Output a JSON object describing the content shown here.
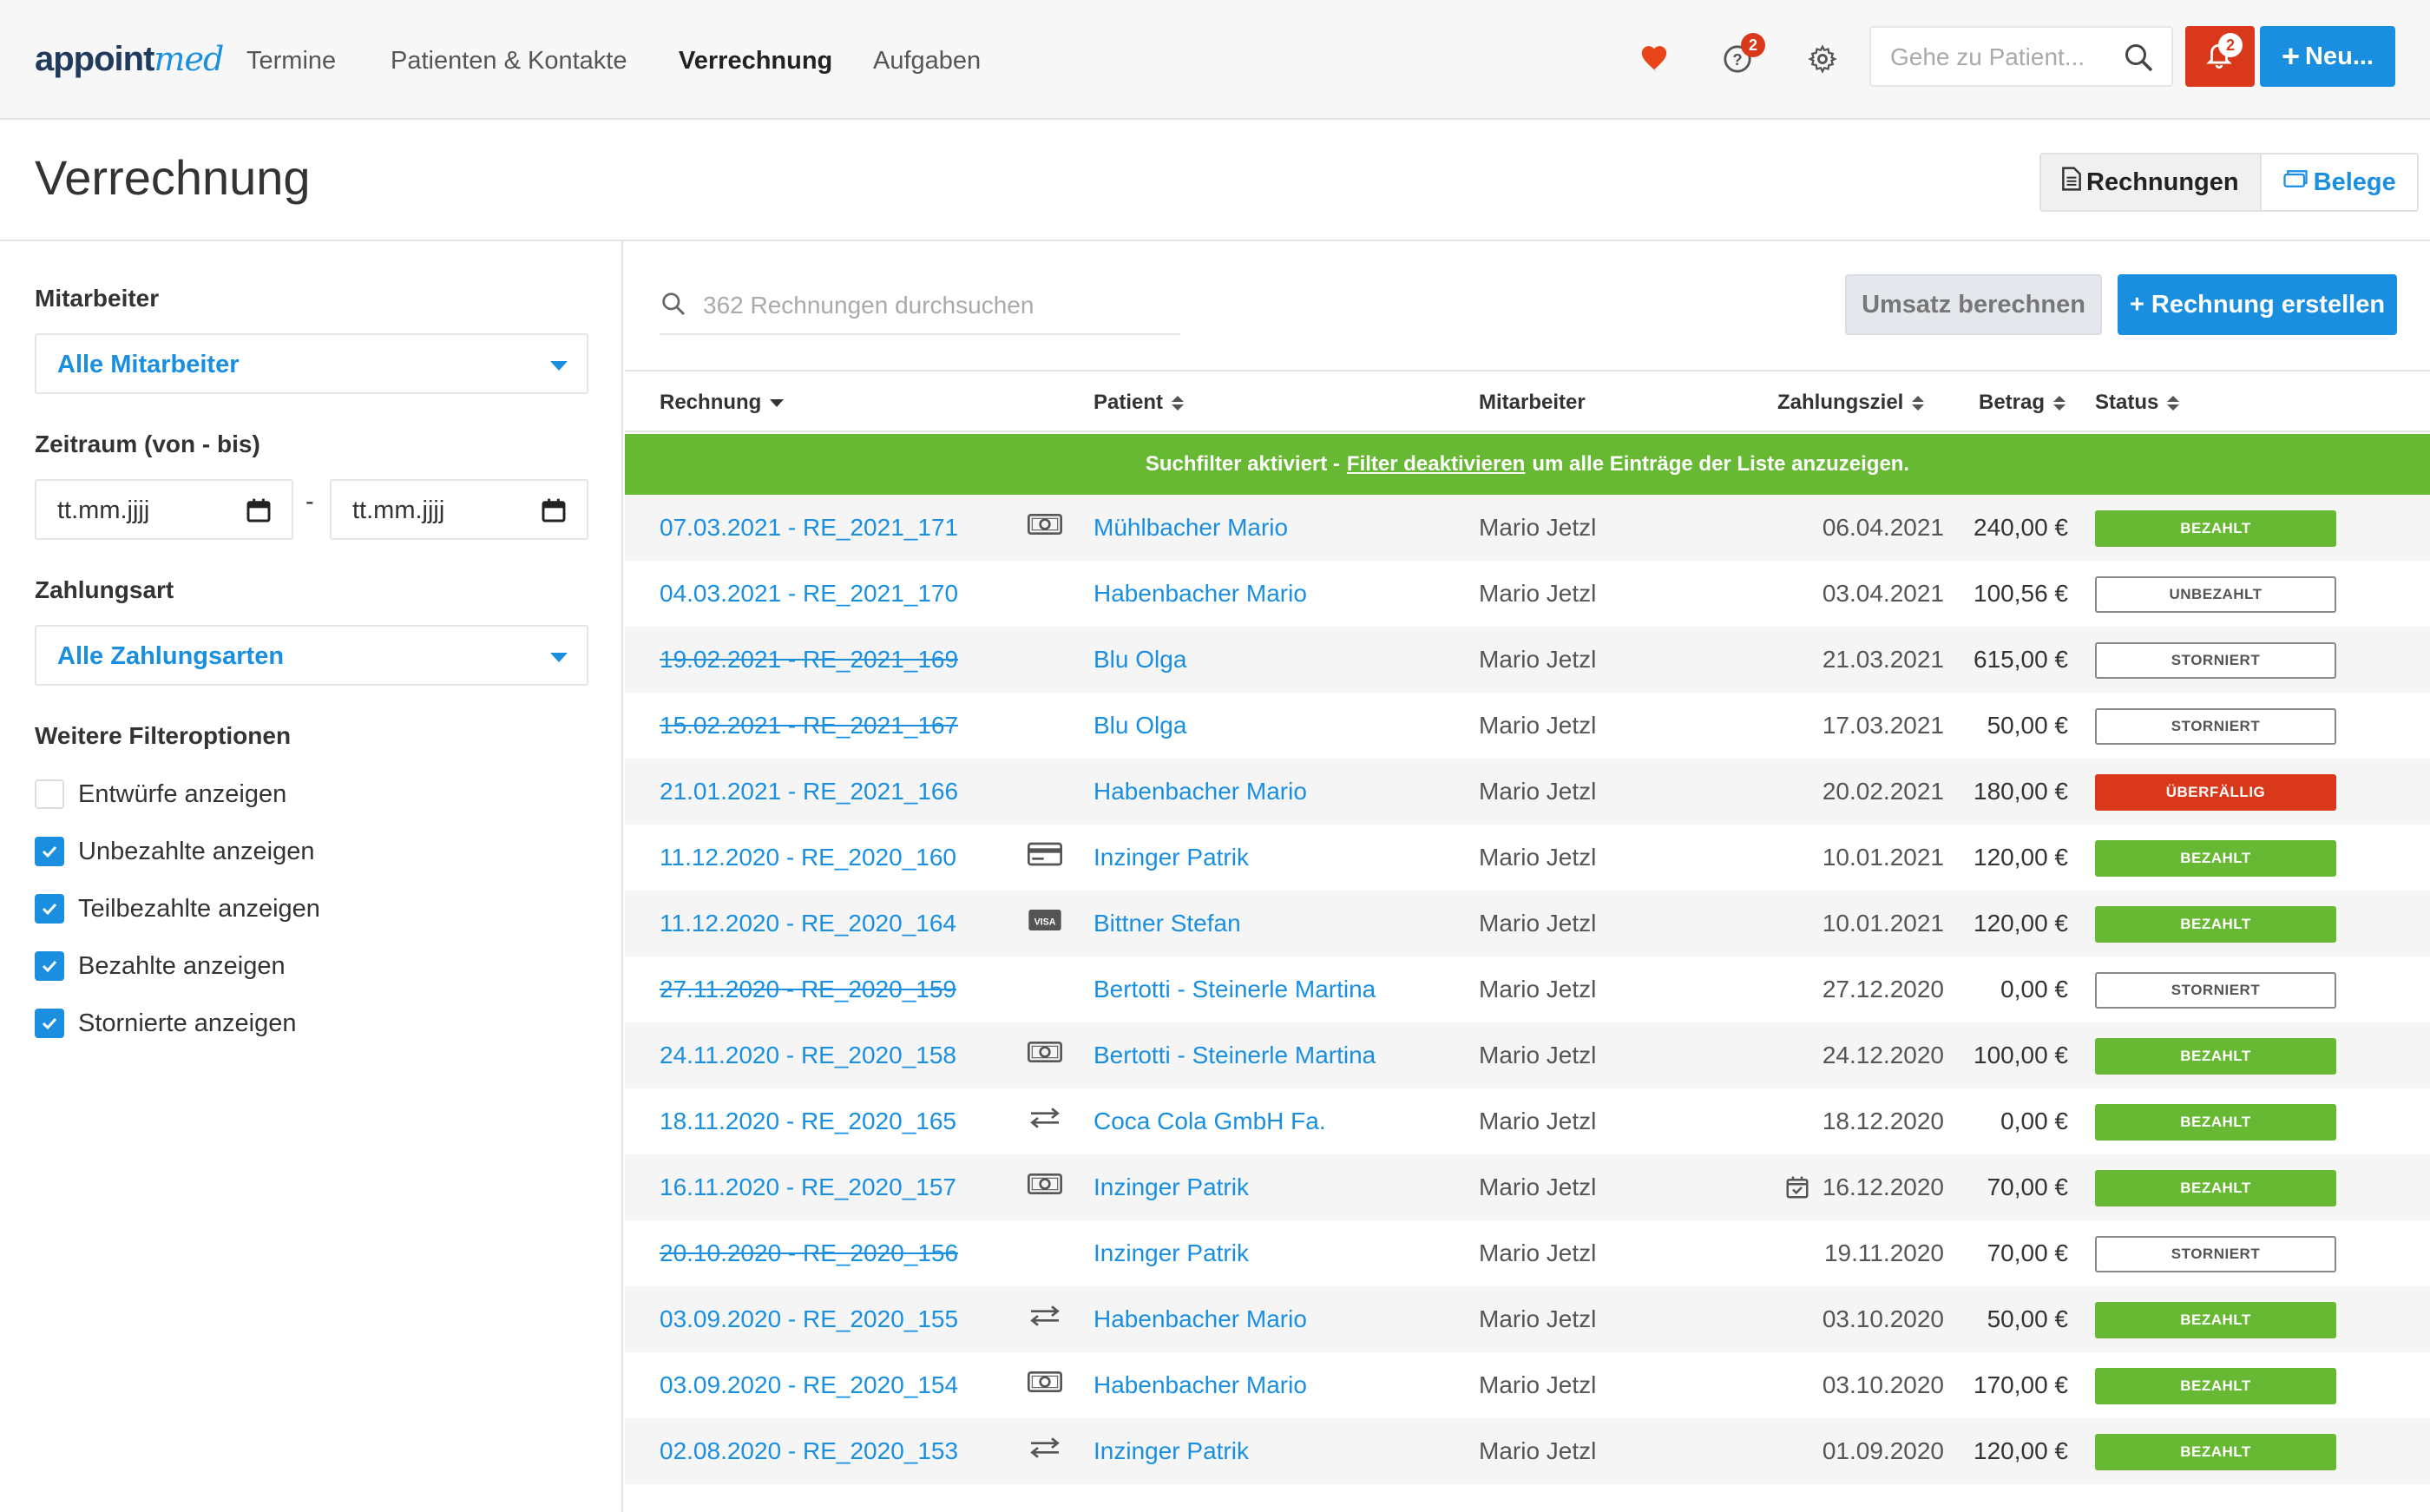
{
  "app": {
    "logo_main": "appoint",
    "logo_accent": "med",
    "nav": [
      "Termine",
      "Patienten & Kontakte",
      "Verrechnung",
      "Aufgaben"
    ],
    "help_badge": "2",
    "notif_badge": "2",
    "search_placeholder": "Gehe zu Patient...",
    "new_button": "Neu..."
  },
  "page": {
    "title": "Verrechnung",
    "toggle": [
      "Rechnungen",
      "Belege"
    ]
  },
  "filters": {
    "employee_label": "Mitarbeiter",
    "employee_value": "Alle Mitarbeiter",
    "period_label": "Zeitraum (von - bis)",
    "date_from": "tt.mm.jjjj",
    "date_to": "tt.mm.jjjj",
    "date_sep": "-",
    "payment_label": "Zahlungsart",
    "payment_value": "Alle Zahlungsarten",
    "more_label": "Weitere Filteroptionen",
    "options": [
      {
        "label": "Entwürfe anzeigen",
        "checked": false
      },
      {
        "label": "Unbezahlte anzeigen",
        "checked": true
      },
      {
        "label": "Teilbezahlte anzeigen",
        "checked": true
      },
      {
        "label": "Bezahlte anzeigen",
        "checked": true
      },
      {
        "label": "Stornierte anzeigen",
        "checked": true
      }
    ]
  },
  "list": {
    "search_placeholder": "362 Rechnungen durchsuchen",
    "umsatz_button": "Umsatz berechnen",
    "create_button": "+ Rechnung erstellen",
    "columns": [
      "Rechnung",
      "Patient",
      "Mitarbeiter",
      "Zahlungsziel",
      "Betrag",
      "Status"
    ],
    "filter_notice_a": "Suchfilter aktiviert -",
    "filter_notice_link": "Filter deaktivieren",
    "filter_notice_b": "um alle Einträge der Liste anzuzeigen.",
    "rows": [
      {
        "invoice": "07.03.2021 - RE_2021_171",
        "cancelled": false,
        "pay": "cash-icon",
        "patient": "Mühlbacher Mario",
        "employee": "Mario Jetzl",
        "due": "06.04.2021",
        "amount": "240,00 €",
        "status": "BEZAHLT",
        "kind": "paid",
        "cal": false
      },
      {
        "invoice": "04.03.2021 - RE_2021_170",
        "cancelled": false,
        "pay": "",
        "patient": "Habenbacher Mario",
        "employee": "Mario Jetzl",
        "due": "03.04.2021",
        "amount": "100,56 €",
        "status": "UNBEZAHLT",
        "kind": "out",
        "cal": false
      },
      {
        "invoice": "19.02.2021 - RE_2021_169",
        "cancelled": true,
        "pay": "",
        "patient": "Blu Olga",
        "employee": "Mario Jetzl",
        "due": "21.03.2021",
        "amount": "615,00 €",
        "status": "STORNIERT",
        "kind": "out",
        "cal": false
      },
      {
        "invoice": "15.02.2021 - RE_2021_167",
        "cancelled": true,
        "pay": "",
        "patient": "Blu Olga",
        "employee": "Mario Jetzl",
        "due": "17.03.2021",
        "amount": "50,00 €",
        "status": "STORNIERT",
        "kind": "out",
        "cal": false
      },
      {
        "invoice": "21.01.2021 - RE_2021_166",
        "cancelled": false,
        "pay": "",
        "patient": "Habenbacher Mario",
        "employee": "Mario Jetzl",
        "due": "20.02.2021",
        "amount": "180,00 €",
        "status": "ÜBERFÄLLIG",
        "kind": "over",
        "cal": false
      },
      {
        "invoice": "11.12.2020 - RE_2020_160",
        "cancelled": false,
        "pay": "card-icon",
        "patient": "Inzinger Patrik",
        "employee": "Mario Jetzl",
        "due": "10.01.2021",
        "amount": "120,00 €",
        "status": "BEZAHLT",
        "kind": "paid",
        "cal": false
      },
      {
        "invoice": "11.12.2020 - RE_2020_164",
        "cancelled": false,
        "pay": "visa-icon",
        "patient": "Bittner Stefan",
        "employee": "Mario Jetzl",
        "due": "10.01.2021",
        "amount": "120,00 €",
        "status": "BEZAHLT",
        "kind": "paid",
        "cal": false
      },
      {
        "invoice": "27.11.2020 - RE_2020_159",
        "cancelled": true,
        "pay": "",
        "patient": "Bertotti - Steinerle Martina",
        "employee": "Mario Jetzl",
        "due": "27.12.2020",
        "amount": "0,00 €",
        "status": "STORNIERT",
        "kind": "out",
        "cal": false
      },
      {
        "invoice": "24.11.2020 - RE_2020_158",
        "cancelled": false,
        "pay": "cash-icon",
        "patient": "Bertotti - Steinerle Martina",
        "employee": "Mario Jetzl",
        "due": "24.12.2020",
        "amount": "100,00 €",
        "status": "BEZAHLT",
        "kind": "paid",
        "cal": false
      },
      {
        "invoice": "18.11.2020 - RE_2020_165",
        "cancelled": false,
        "pay": "transfer-icon",
        "patient": "Coca Cola GmbH Fa.",
        "employee": "Mario Jetzl",
        "due": "18.12.2020",
        "amount": "0,00 €",
        "status": "BEZAHLT",
        "kind": "paid",
        "cal": false
      },
      {
        "invoice": "16.11.2020 - RE_2020_157",
        "cancelled": false,
        "pay": "cash-icon",
        "patient": "Inzinger Patrik",
        "employee": "Mario Jetzl",
        "due": "16.12.2020",
        "amount": "70,00 €",
        "status": "BEZAHLT",
        "kind": "paid",
        "cal": true
      },
      {
        "invoice": "20.10.2020 - RE_2020_156",
        "cancelled": true,
        "pay": "",
        "patient": "Inzinger Patrik",
        "employee": "Mario Jetzl",
        "due": "19.11.2020",
        "amount": "70,00 €",
        "status": "STORNIERT",
        "kind": "out",
        "cal": false
      },
      {
        "invoice": "03.09.2020 - RE_2020_155",
        "cancelled": false,
        "pay": "transfer-icon",
        "patient": "Habenbacher Mario",
        "employee": "Mario Jetzl",
        "due": "03.10.2020",
        "amount": "50,00 €",
        "status": "BEZAHLT",
        "kind": "paid",
        "cal": false
      },
      {
        "invoice": "03.09.2020 - RE_2020_154",
        "cancelled": false,
        "pay": "cash-icon",
        "patient": "Habenbacher Mario",
        "employee": "Mario Jetzl",
        "due": "03.10.2020",
        "amount": "170,00 €",
        "status": "BEZAHLT",
        "kind": "paid",
        "cal": false
      },
      {
        "invoice": "02.08.2020 - RE_2020_153",
        "cancelled": false,
        "pay": "transfer-icon",
        "patient": "Inzinger Patrik",
        "employee": "Mario Jetzl",
        "due": "01.09.2020",
        "amount": "120,00 €",
        "status": "BEZAHLT",
        "kind": "paid",
        "cal": false
      }
    ]
  },
  "colors": {
    "accent": "#1a8fe0",
    "paid": "#67b832",
    "overdue": "#d9391a"
  }
}
